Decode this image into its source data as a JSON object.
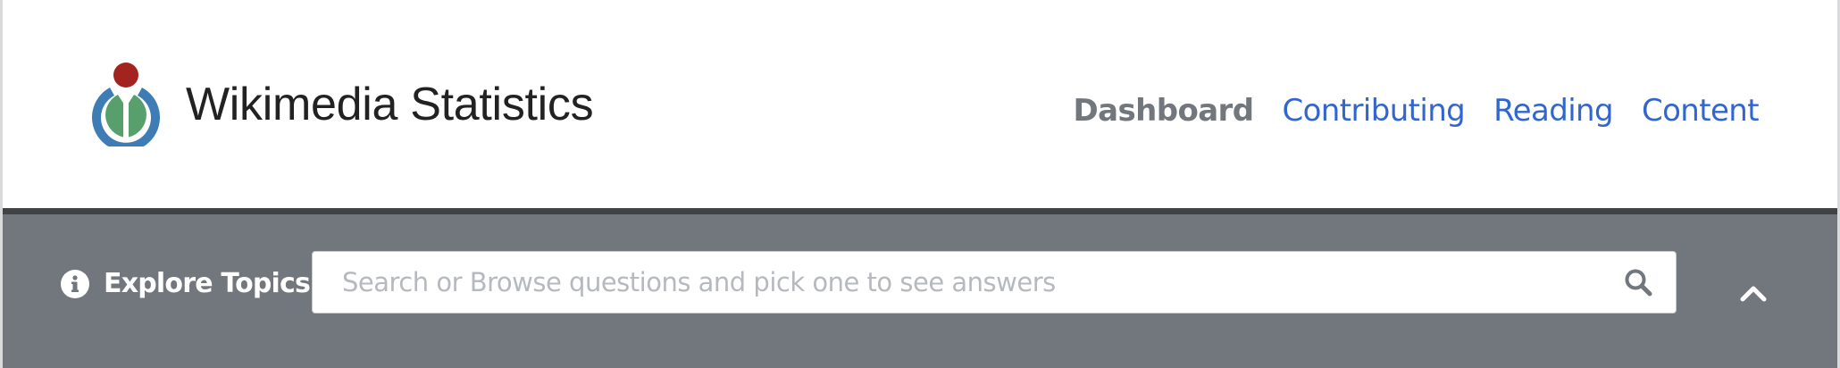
{
  "header": {
    "title": "Wikimedia Statistics",
    "logo_icon": "wikimedia-logo",
    "nav": [
      {
        "label": "Dashboard",
        "active": true
      },
      {
        "label": "Contributing",
        "active": false
      },
      {
        "label": "Reading",
        "active": false
      },
      {
        "label": "Content",
        "active": false
      }
    ]
  },
  "topics": {
    "icon": "info-icon",
    "label": "Explore Topics",
    "search": {
      "placeholder": "Search or Browse questions and pick one to see answers",
      "value": "",
      "icon": "search-icon"
    },
    "toggle_icon": "chevron-up-icon"
  },
  "colors": {
    "link": "#3366cc",
    "active_nav": "#72777d",
    "topic_bar": "#72777d",
    "topic_bar_border": "#404244",
    "logo_red": "#990000",
    "logo_green": "#339966",
    "logo_blue": "#006699"
  }
}
